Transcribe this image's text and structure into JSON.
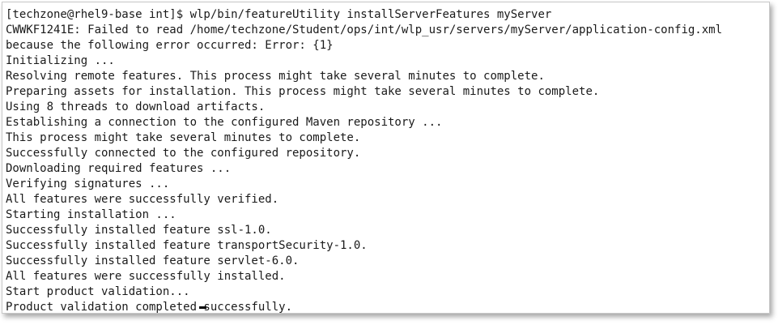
{
  "terminal": {
    "lines": [
      "[techzone@rhel9-base int]$ wlp/bin/featureUtility installServerFeatures myServer",
      "CWWKF1241E: Failed to read /home/techzone/Student/ops/int/wlp_usr/servers/myServer/application-config.xml",
      "because the following error occurred: Error: {1}",
      "Initializing ...",
      "Resolving remote features. This process might take several minutes to complete.",
      "Preparing assets for installation. This process might take several minutes to complete.",
      "Using 8 threads to download artifacts.",
      "Establishing a connection to the configured Maven repository ...",
      "This process might take several minutes to complete.",
      "Successfully connected to the configured repository.",
      "Downloading required features ...",
      "Verifying signatures ...",
      "All features were successfully verified.",
      "Starting installation ...",
      "Successfully installed feature ssl-1.0.",
      "Successfully installed feature transportSecurity-1.0.",
      "Successfully installed feature servlet-6.0.",
      "All features were successfully installed.",
      "Start product validation...",
      "Product validation completed successfully."
    ]
  }
}
